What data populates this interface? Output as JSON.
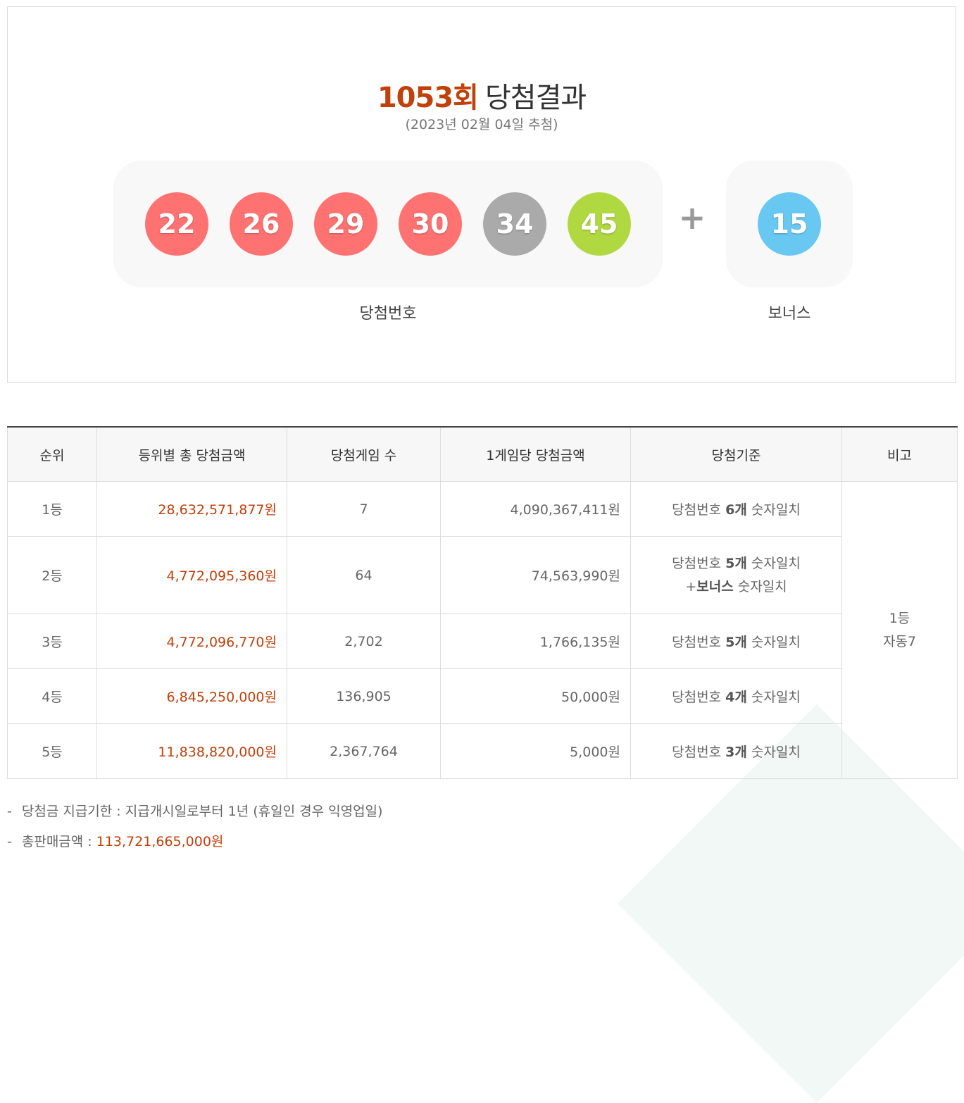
{
  "header": {
    "round": "1053회",
    "title_suffix": "당첨결과",
    "draw_date": "(2023년 02월 04일 추첨)"
  },
  "winning": {
    "label": "당첨번호",
    "numbers": [
      {
        "value": "22",
        "color": "#ff7272"
      },
      {
        "value": "26",
        "color": "#ff7272"
      },
      {
        "value": "29",
        "color": "#ff7272"
      },
      {
        "value": "30",
        "color": "#ff7272"
      },
      {
        "value": "34",
        "color": "#aaaaaa"
      },
      {
        "value": "45",
        "color": "#b0d840"
      }
    ]
  },
  "bonus": {
    "label": "보너스",
    "number": {
      "value": "15",
      "color": "#69c8f2"
    },
    "plus_symbol": "+"
  },
  "table": {
    "headers": [
      "순위",
      "등위별 총 당첨금액",
      "당첨게임 수",
      "1게임당 당첨금액",
      "당첨기준",
      "비고"
    ],
    "rows": [
      {
        "rank": "1등",
        "total": "28,632,571,877원",
        "games": "7",
        "per_game": "4,090,367,411원",
        "crit_pre": "당첨번호 ",
        "crit_bold": "6개",
        "crit_post": " 숫자일치"
      },
      {
        "rank": "2등",
        "total": "4,772,095,360원",
        "games": "64",
        "per_game": "74,563,990원",
        "crit_pre": "당첨번호 ",
        "crit_bold": "5개",
        "crit_post": " 숫자일치",
        "crit2_pre": "+",
        "crit2_bold": "보너스",
        "crit2_post": " 숫자일치"
      },
      {
        "rank": "3등",
        "total": "4,772,096,770원",
        "games": "2,702",
        "per_game": "1,766,135원",
        "crit_pre": "당첨번호 ",
        "crit_bold": "5개",
        "crit_post": " 숫자일치"
      },
      {
        "rank": "4등",
        "total": "6,845,250,000원",
        "games": "136,905",
        "per_game": "50,000원",
        "crit_pre": "당첨번호 ",
        "crit_bold": "4개",
        "crit_post": " 숫자일치"
      },
      {
        "rank": "5등",
        "total": "11,838,820,000원",
        "games": "2,367,764",
        "per_game": "5,000원",
        "crit_pre": "당첨번호 ",
        "crit_bold": "3개",
        "crit_post": " 숫자일치"
      }
    ],
    "note_line1": "1등",
    "note_line2": "자동7"
  },
  "footnotes": {
    "dash": "-",
    "deadline": "당첨금 지급기한 : 지급개시일로부터 1년 (휴일인 경우 익영업일)",
    "sales_label": "총판매금액 : ",
    "sales_value": "113,721,665,000원"
  },
  "colors": {
    "accent_red": "#c0410a",
    "panel_bg": "#f8f8f8"
  }
}
